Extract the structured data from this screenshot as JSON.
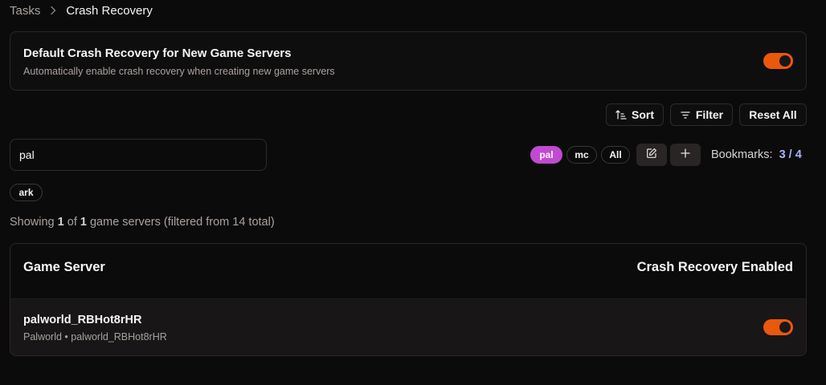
{
  "breadcrumb": {
    "parent": "Tasks",
    "current": "Crash Recovery"
  },
  "default_card": {
    "title": "Default Crash Recovery for New Game Servers",
    "description": "Automatically enable crash recovery when creating new game servers",
    "enabled": true
  },
  "toolbar": {
    "sort_label": "Sort",
    "filter_label": "Filter",
    "reset_label": "Reset All"
  },
  "search": {
    "value": "pal"
  },
  "bookmark_pills": [
    {
      "label": "pal",
      "active": true
    },
    {
      "label": "mc",
      "active": false
    },
    {
      "label": "All",
      "active": false
    }
  ],
  "bookmarks": {
    "label": "Bookmarks:",
    "count": "3 / 4"
  },
  "tag_chips": [
    {
      "label": "ark"
    }
  ],
  "showing": {
    "prefix": "Showing ",
    "shown": "1",
    "mid": " of ",
    "total_filtered": "1",
    "suffix": " game servers (filtered from 14 total)"
  },
  "table": {
    "headers": {
      "server": "Game Server",
      "recovery": "Crash Recovery Enabled"
    },
    "rows": [
      {
        "name": "palworld_RBHot8rHR",
        "subtitle": "Palworld • palworld_RBHot8rHR",
        "enabled": true
      }
    ]
  },
  "colors": {
    "accent": "#ea580c",
    "pill_active": "#c04bd0",
    "bookmark_count": "#a5b4fc"
  },
  "icons": {
    "breadcrumb_sep": "chevron-right-icon",
    "sort": "sort-icon",
    "filter": "filter-icon",
    "edit": "edit-icon",
    "add": "plus-icon"
  }
}
